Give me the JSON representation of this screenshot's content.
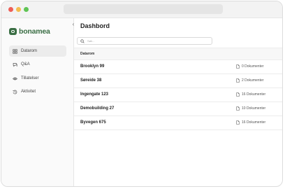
{
  "nav": [
    {
      "label": "Datarom",
      "icon": "grid-icon",
      "active": true
    },
    {
      "label": "Q&A",
      "icon": "chat-icon",
      "active": false
    },
    {
      "label": "Tillatelser",
      "icon": "eye-icon",
      "active": false
    },
    {
      "label": "Aktivitet",
      "icon": "history-icon",
      "active": false
    }
  ],
  "brand": {
    "name": "bonamea",
    "color": "#3a6e44"
  },
  "main": {
    "title": "Dashbord",
    "search_placeholder": "Søk...",
    "column_header": "Datarom",
    "rows": [
      {
        "name": "Brooklyn 99",
        "docs": "0 Dokumenter"
      },
      {
        "name": "Søreide 38",
        "docs": "2 Dokumenter"
      },
      {
        "name": "Ingengate 123",
        "docs": "16 Dokumenter"
      },
      {
        "name": "Demobuilding 27",
        "docs": "10 Dokumenter"
      },
      {
        "name": "Byvegen 675",
        "docs": "16 Dokumenter"
      }
    ]
  }
}
